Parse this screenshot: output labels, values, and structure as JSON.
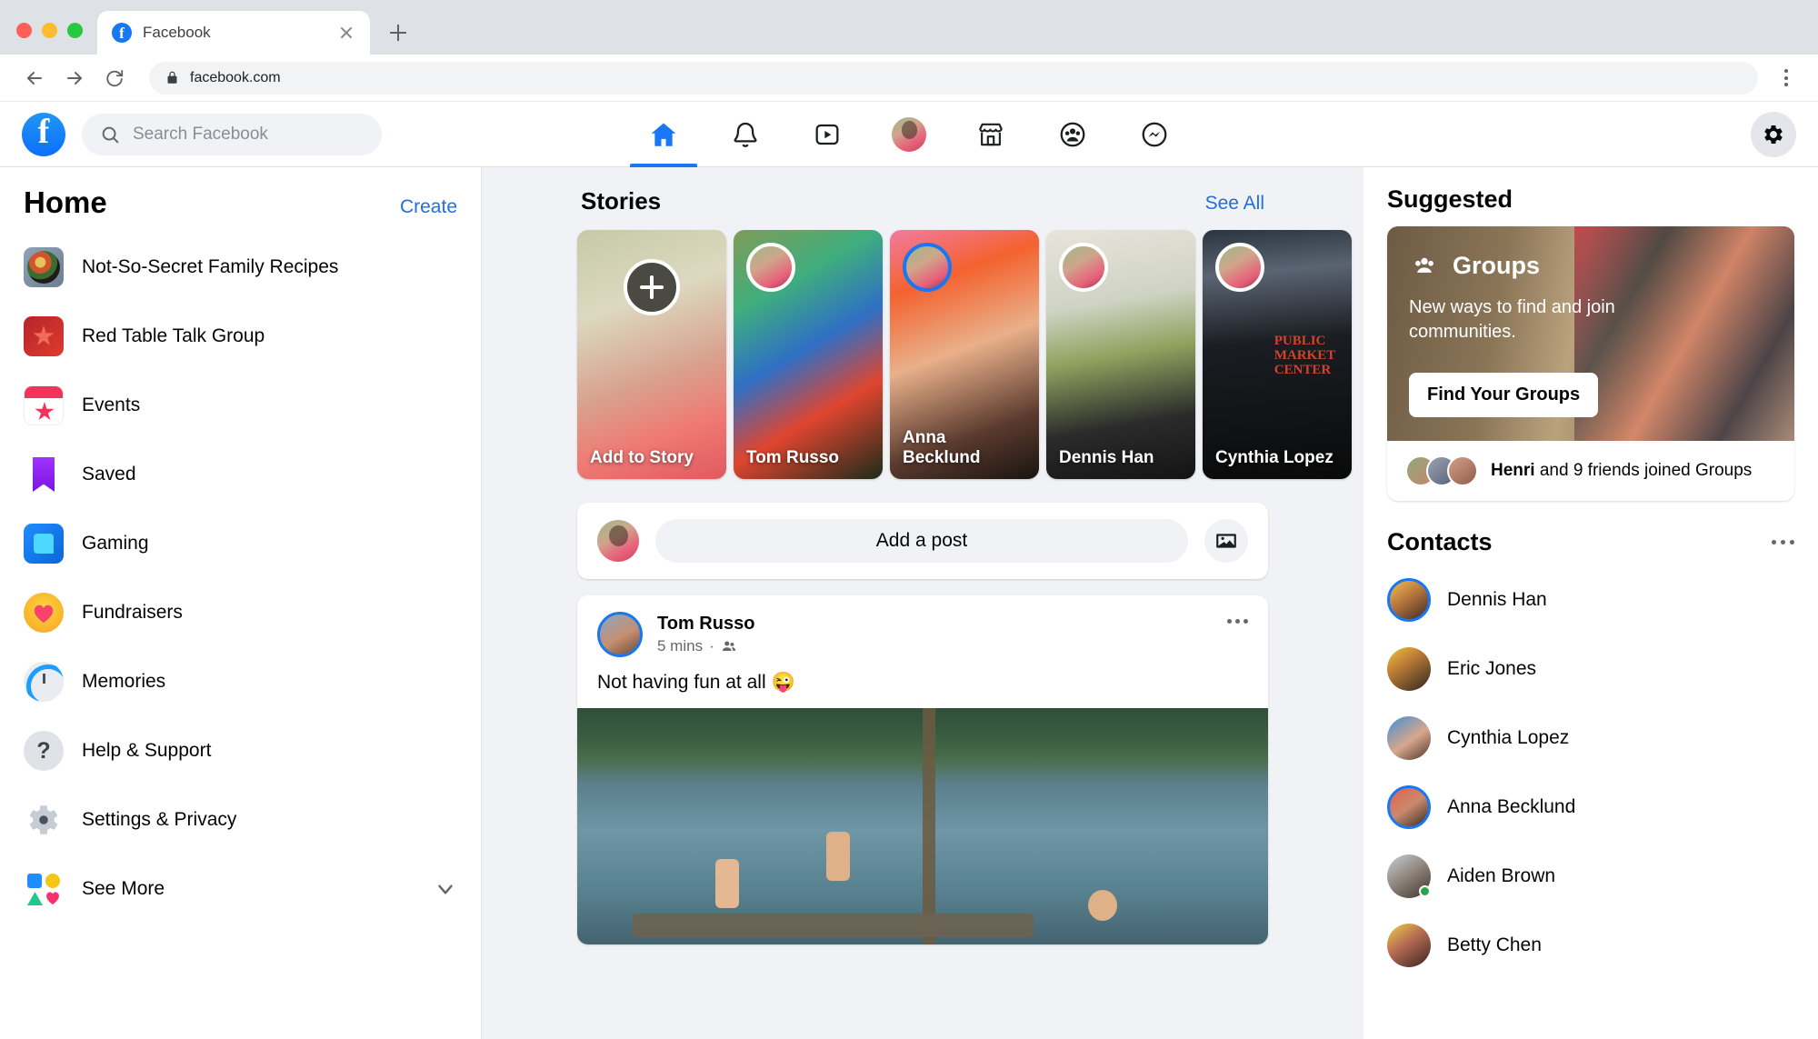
{
  "browser": {
    "tab_title": "Facebook",
    "tab_favicon_letter": "f",
    "url": "facebook.com",
    "back_icon": "back-arrow-icon",
    "forward_icon": "forward-arrow-icon",
    "reload_icon": "reload-icon",
    "lock_icon": "lock-icon",
    "menu_icon": "kebab-menu-icon",
    "new_tab_icon": "new-tab-icon",
    "close_tab_icon": "close-icon"
  },
  "header": {
    "logo_letter": "f",
    "search_placeholder": "Search Facebook",
    "search_value": "",
    "nav": [
      {
        "name": "home",
        "icon": "home-icon",
        "active": true
      },
      {
        "name": "notifications",
        "icon": "bell-icon",
        "active": false
      },
      {
        "name": "watch",
        "icon": "video-play-icon",
        "active": false
      },
      {
        "name": "profile",
        "icon": "profile-avatar",
        "active": false
      },
      {
        "name": "marketplace",
        "icon": "shop-icon",
        "active": false
      },
      {
        "name": "groups",
        "icon": "people-circle-icon",
        "active": false
      },
      {
        "name": "messenger",
        "icon": "messenger-icon",
        "active": false
      }
    ],
    "settings_icon": "gear-icon"
  },
  "sidebar": {
    "title": "Home",
    "create_label": "Create",
    "items": [
      {
        "label": "Not-So-Secret Family Recipes",
        "icon": "recipes-group-thumbnail"
      },
      {
        "label": "Red Table Talk Group",
        "icon": "red-table-talk-thumbnail"
      },
      {
        "label": "Events",
        "icon": "calendar-star-icon"
      },
      {
        "label": "Saved",
        "icon": "bookmark-icon"
      },
      {
        "label": "Gaming",
        "icon": "gaming-icon"
      },
      {
        "label": "Fundraisers",
        "icon": "heart-circle-icon"
      },
      {
        "label": "Memories",
        "icon": "clock-rewind-icon"
      },
      {
        "label": "Help & Support",
        "icon": "question-circle-icon"
      },
      {
        "label": "Settings & Privacy",
        "icon": "gear-icon"
      },
      {
        "label": "See More",
        "icon": "shapes-icon",
        "chevron": "chevron-down-icon"
      }
    ]
  },
  "stories": {
    "title": "Stories",
    "see_all_label": "See All",
    "items": [
      {
        "name": "Add to Story",
        "type": "add",
        "add_icon": "plus-icon"
      },
      {
        "name": "Tom Russo",
        "type": "story"
      },
      {
        "name": "Anna Becklund",
        "type": "story"
      },
      {
        "name": "Dennis Han",
        "type": "story"
      },
      {
        "name": "Cynthia Lopez",
        "type": "story",
        "overlay_text": "PUBLIC MARKET CENTER"
      }
    ]
  },
  "composer": {
    "placeholder": "Add a post",
    "photo_icon": "photo-icon",
    "avatar": "user-avatar"
  },
  "post": {
    "author": "Tom Russo",
    "time": "5 mins",
    "audience_icon": "friends-icon",
    "separator": "·",
    "text": "Not having fun at all 😜",
    "more_icon": "more-options-icon"
  },
  "suggested": {
    "title": "Suggested",
    "card": {
      "badge_icon": "groups-icon",
      "badge_label": "Groups",
      "description": "New ways to find and join communities.",
      "button_label": "Find Your Groups",
      "footer_name": "Henri",
      "footer_text": "and 9 friends joined Groups"
    }
  },
  "contacts": {
    "title": "Contacts",
    "more_icon": "more-options-icon",
    "items": [
      {
        "name": "Dennis Han",
        "online": false,
        "ring": true
      },
      {
        "name": "Eric Jones",
        "online": false,
        "ring": false
      },
      {
        "name": "Cynthia Lopez",
        "online": false,
        "ring": false
      },
      {
        "name": "Anna Becklund",
        "online": false,
        "ring": true
      },
      {
        "name": "Aiden Brown",
        "online": true,
        "ring": false
      },
      {
        "name": "Betty Chen",
        "online": false,
        "ring": false
      }
    ]
  },
  "colors": {
    "accent": "#1877f2",
    "link": "#216fdb",
    "bg": "#f0f2f5",
    "text": "#050505",
    "muted": "#65676b"
  }
}
